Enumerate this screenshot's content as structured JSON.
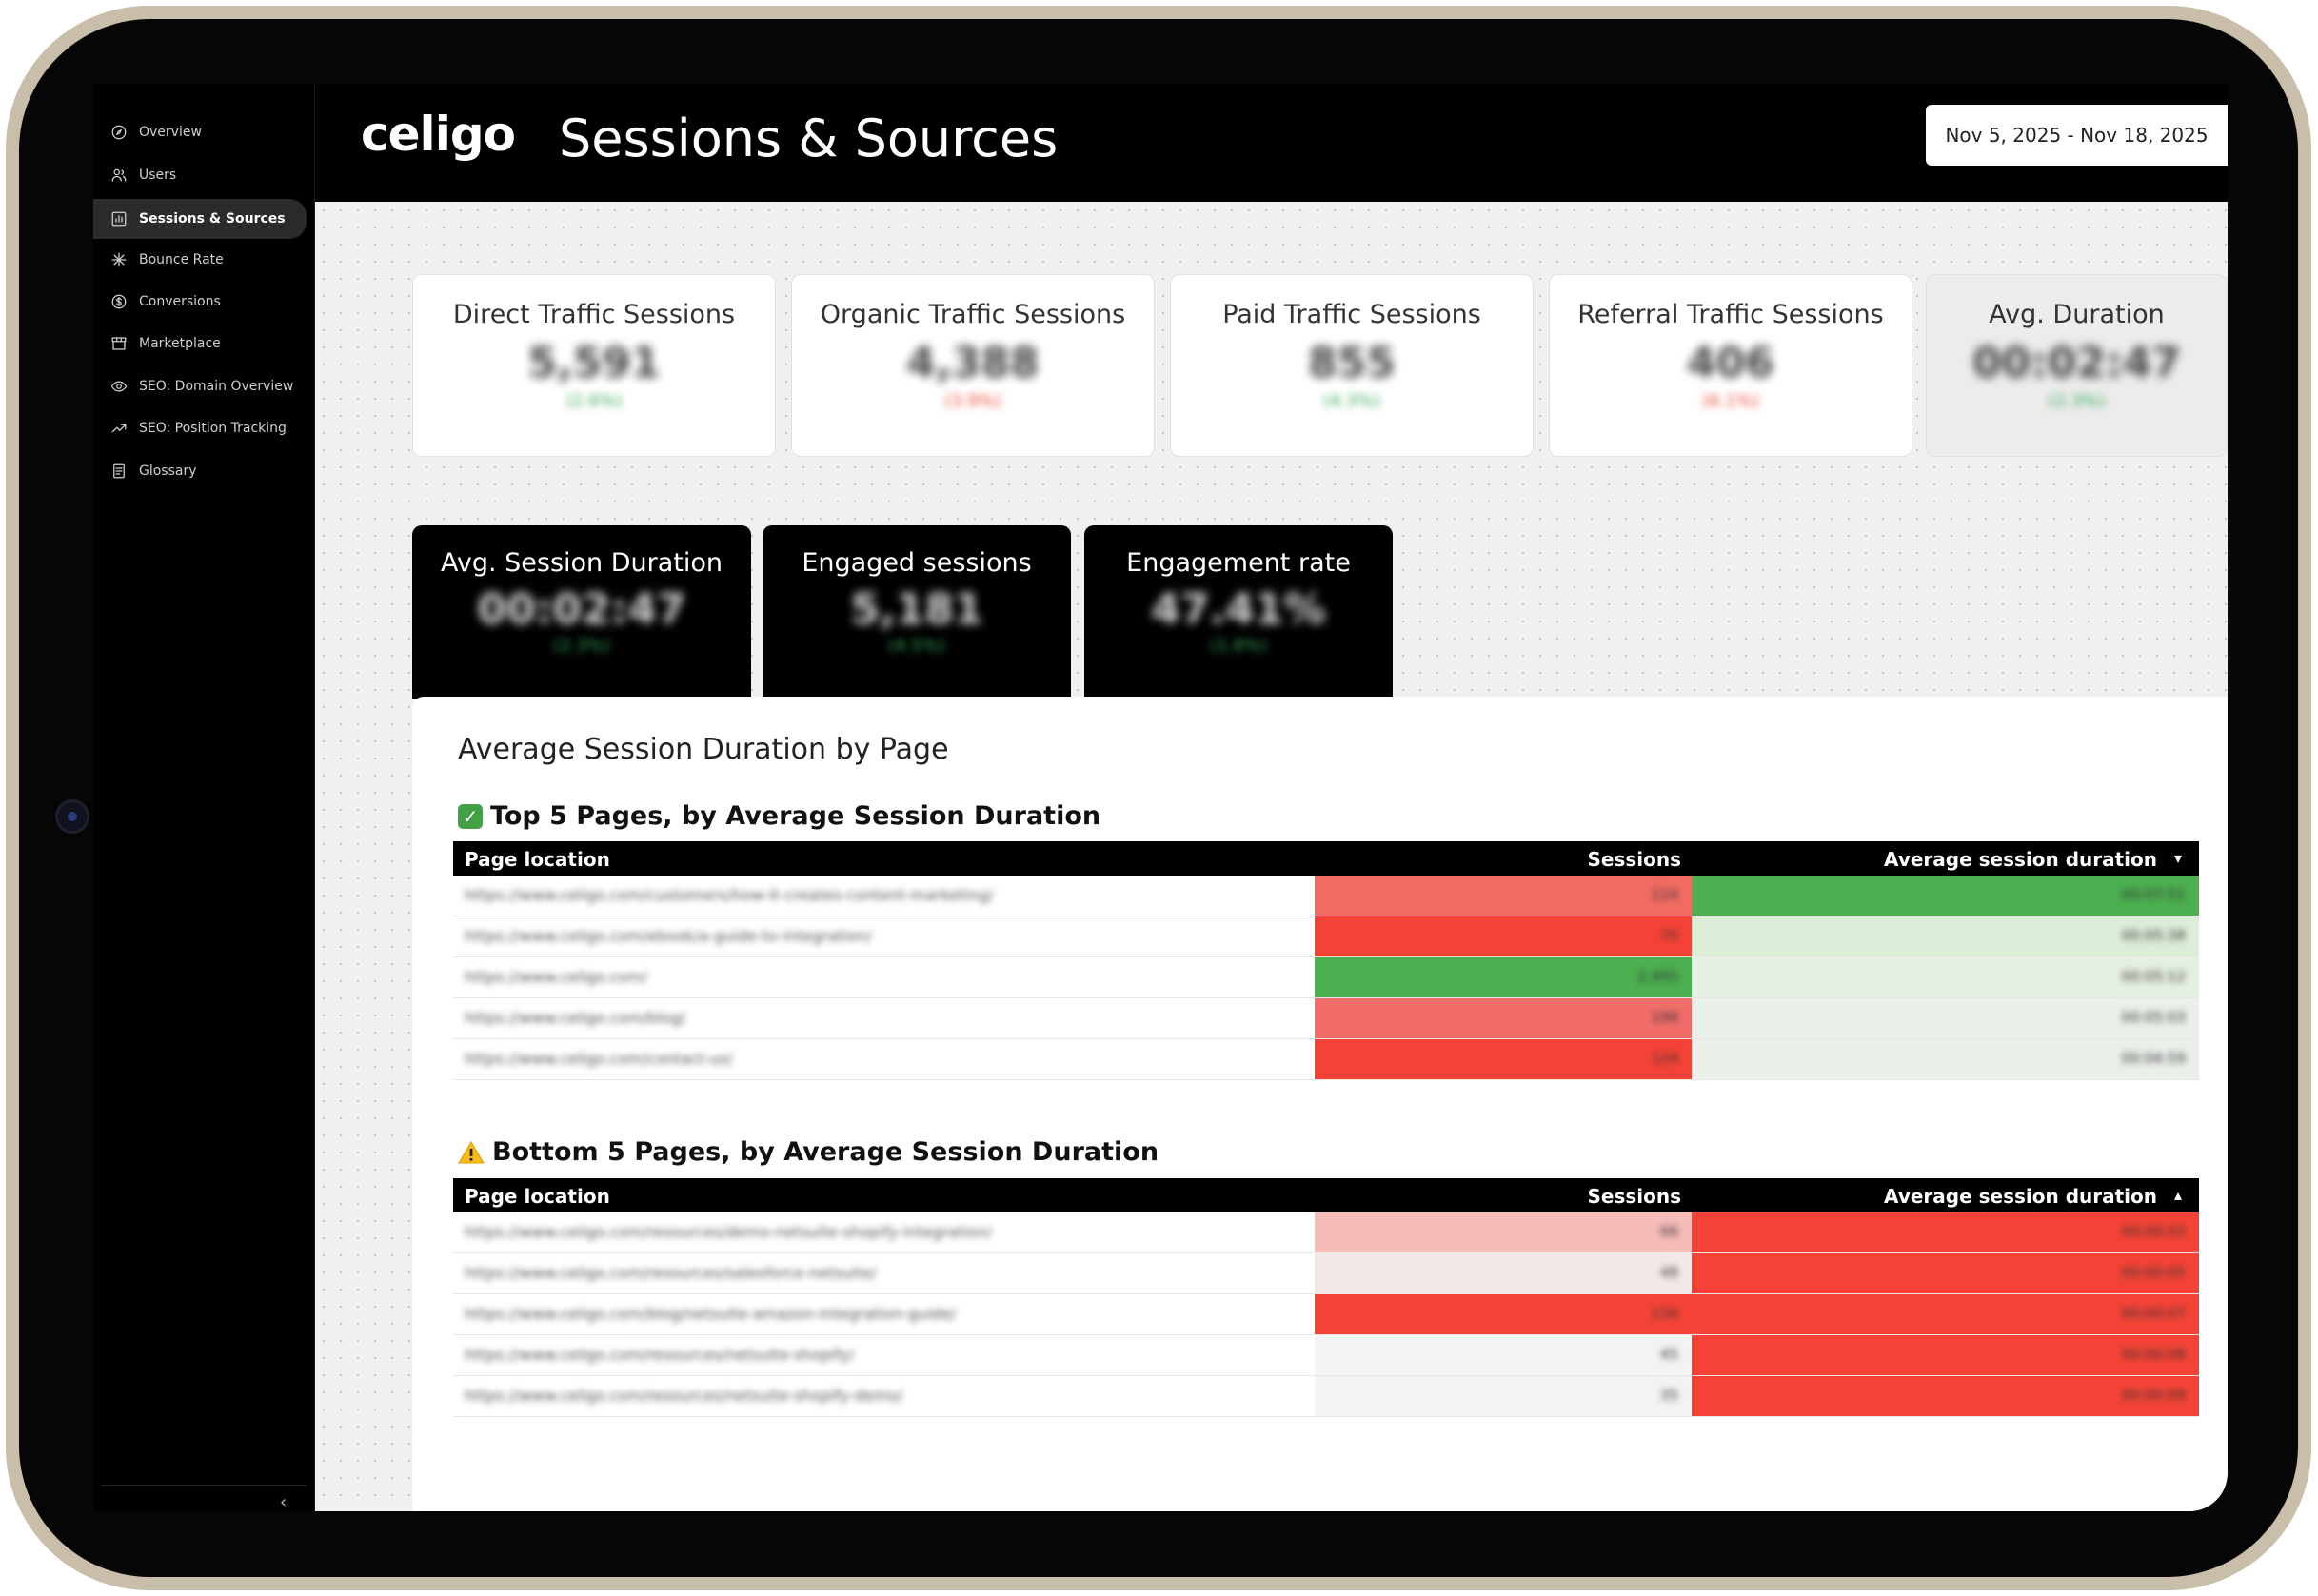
{
  "app": {
    "logo": "celigo",
    "page_title": "Sessions & Sources",
    "date_range": "Nov 5, 2025 - Nov 18, 2025"
  },
  "sidebar": {
    "items": [
      {
        "label": "Overview",
        "icon": "compass-icon"
      },
      {
        "label": "Users",
        "icon": "users-icon"
      },
      {
        "label": "Sessions & Sources",
        "icon": "bar-chart-icon",
        "active": true
      },
      {
        "label": "Bounce Rate",
        "icon": "asterisk-icon"
      },
      {
        "label": "Conversions",
        "icon": "dollar-icon"
      },
      {
        "label": "Marketplace",
        "icon": "store-icon"
      },
      {
        "label": "SEO: Domain Overview",
        "icon": "eye-icon"
      },
      {
        "label": "SEO: Position Tracking",
        "icon": "trend-icon"
      },
      {
        "label": "Glossary",
        "icon": "document-icon"
      }
    ],
    "collapse_glyph": "‹"
  },
  "kpis": [
    {
      "title": "Direct Traffic Sessions",
      "value": "5,591",
      "delta": "(2.6%)",
      "trend": "pos"
    },
    {
      "title": "Organic Traffic Sessions",
      "value": "4,388",
      "delta": "(3.9%)",
      "trend": "neg"
    },
    {
      "title": "Paid Traffic Sessions",
      "value": "855",
      "delta": "(4.3%)",
      "trend": "pos"
    },
    {
      "title": "Referral Traffic Sessions",
      "value": "406",
      "delta": "(6.1%)",
      "trend": "neg"
    },
    {
      "title": "Avg. Duration",
      "value": "00:02:47",
      "delta": "(2.3%)",
      "trend": "pos"
    }
  ],
  "dark_kpis": [
    {
      "title": "Avg. Session Duration",
      "value": "00:02:47",
      "delta": "(2.3%)"
    },
    {
      "title": "Engaged sessions",
      "value": "5,181",
      "delta": "(4.5%)"
    },
    {
      "title": "Engagement rate",
      "value": "47.41%",
      "delta": "(1.8%)"
    }
  ],
  "panel": {
    "title": "Average Session Duration by Page"
  },
  "top_table": {
    "title": "Top 5 Pages, by Average Session Duration",
    "columns": [
      "Page location",
      "Sessions",
      "Average session duration"
    ],
    "sort_glyph": "▾",
    "rows": [
      {
        "page": "https://www.celigo.com/customers/how-it-creates-content-marketing/",
        "sessions": "124",
        "duration": "00:07:51",
        "ses_color": "#f16b63",
        "dur_color": "#4caf50"
      },
      {
        "page": "https://www.celigo.com/ebook/a-guide-to-integration/",
        "sessions": "70",
        "duration": "00:05:38",
        "ses_color": "#f44336",
        "dur_color": "#dcedd8"
      },
      {
        "page": "https://www.celigo.com/",
        "sessions": "2,495",
        "duration": "00:05:12",
        "ses_color": "#4caf50",
        "dur_color": "#e5efe2"
      },
      {
        "page": "https://www.celigo.com/blog/",
        "sessions": "198",
        "duration": "00:05:03",
        "ses_color": "#f26d69",
        "dur_color": "#e9f0e7"
      },
      {
        "page": "https://www.celigo.com/contact-us/",
        "sessions": "124",
        "duration": "00:04:59",
        "ses_color": "#f44336",
        "dur_color": "#ebefea"
      }
    ]
  },
  "bottom_table": {
    "title": "Bottom 5 Pages, by Average Session Duration",
    "columns": [
      "Page location",
      "Sessions",
      "Average session duration"
    ],
    "sort_glyph": "▴",
    "rows": [
      {
        "page": "https://www.celigo.com/resources/demo-netsuite-shopify-integration/",
        "sessions": "66",
        "duration": "00:00:03",
        "ses_color": "#f5bcb8",
        "dur_color": "#f44336"
      },
      {
        "page": "https://www.celigo.com/resources/salesforce-netsuite/",
        "sessions": "48",
        "duration": "00:00:05",
        "ses_color": "#f2e8e6",
        "dur_color": "#f44336"
      },
      {
        "page": "https://www.celigo.com/blog/netsuite-amazon-integration-guide/",
        "sessions": "134",
        "duration": "00:00:07",
        "ses_color": "#f44336",
        "dur_color": "#f44336"
      },
      {
        "page": "https://www.celigo.com/resources/netsuite-shopify/",
        "sessions": "45",
        "duration": "00:00:08",
        "ses_color": "#f3f3f3",
        "dur_color": "#f44336"
      },
      {
        "page": "https://www.celigo.com/resources/netsuite-shopify-demo/",
        "sessions": "35",
        "duration": "00:00:09",
        "ses_color": "#f3f3f3",
        "dur_color": "#f44336"
      }
    ]
  }
}
